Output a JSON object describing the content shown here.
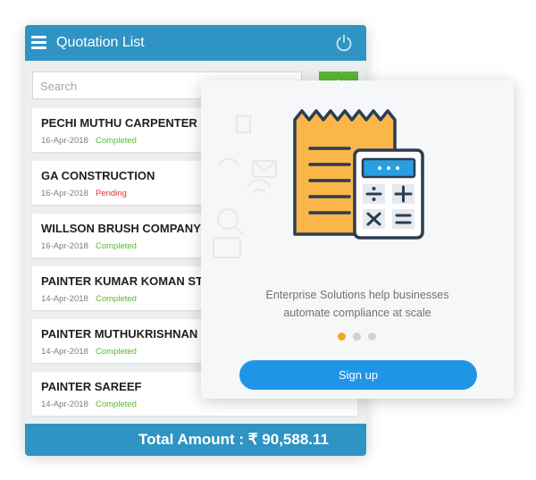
{
  "app": {
    "title": "Quotation List",
    "search_placeholder": "Search",
    "add_label": "+",
    "total_label": "Total Amount : ₹ 90,588.11"
  },
  "quotations": [
    {
      "name": "PECHI MUTHU CARPENTER",
      "date": "16-Apr-2018",
      "status": "Completed",
      "status_color": "#5cb536"
    },
    {
      "name": "GA CONSTRUCTION",
      "date": "16-Apr-2018",
      "status": "Pending",
      "status_color": "#e0352f"
    },
    {
      "name": "WILLSON BRUSH COMPANY",
      "date": "16-Apr-2018",
      "status": "Completed",
      "status_color": "#5cb536"
    },
    {
      "name": "PAINTER KUMAR KOMAN ST",
      "date": "14-Apr-2018",
      "status": "Completed",
      "status_color": "#5cb536"
    },
    {
      "name": "PAINTER MUTHUKRISHNAN",
      "date": "14-Apr-2018",
      "status": "Completed",
      "status_color": "#5cb536"
    },
    {
      "name": "PAINTER SAREEF",
      "date": "14-Apr-2018",
      "status": "Completed",
      "status_color": "#5cb536"
    }
  ],
  "card": {
    "line1": "Enterprise Solutions help businesses",
    "line2": "automate compliance at scale",
    "signup_label": "Sign up",
    "active_dot": 0
  },
  "colors": {
    "primary": "#2f94c4",
    "accent_button": "#2095e6",
    "add_button": "#5cb536",
    "dot_active": "#f6a623",
    "dot_inactive": "#cfd2d4"
  },
  "icons": [
    "menu-icon",
    "power-icon",
    "plus-icon",
    "receipt-calculator-illustration"
  ]
}
